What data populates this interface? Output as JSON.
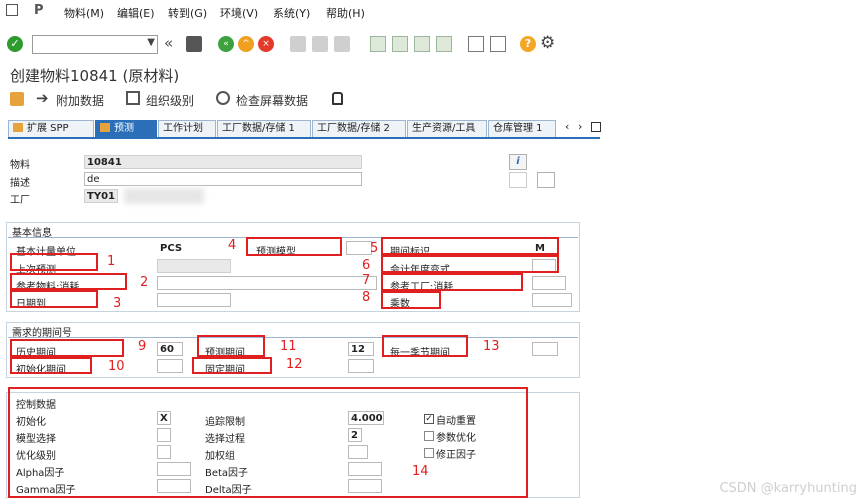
{
  "menu": {
    "items": [
      "物料(M)",
      "编辑(E)",
      "转到(G)",
      "环境(V)",
      "系统(Y)",
      "帮助(H)"
    ]
  },
  "title": "创建物料10841 (原材料)",
  "app_toolbar": {
    "additional_data": "附加数据",
    "org_levels": "组织级别",
    "check_screen": "检查屏幕数据"
  },
  "tabs": [
    "扩展 SPP",
    "预测",
    "工作计划",
    "工厂数据/存储 1",
    "工厂数据/存储 2",
    "生产资源/工具",
    "仓库管理 1"
  ],
  "active_tab": "预测",
  "header": {
    "material_label": "物料",
    "material_value": "10841",
    "desc_label": "描述",
    "desc_value": "de",
    "plant_label": "工厂",
    "plant_value": "TY01"
  },
  "basic": {
    "title": "基本信息",
    "base_unit_label": "基本计量单位",
    "base_unit_value": "PCS",
    "forecast_model_label": "预测模型",
    "period_indicator_label": "期间标识",
    "period_indicator_value": "M",
    "last_forecast_label": "上次预测",
    "fiscal_year_variant_label": "会计年度变式",
    "ref_material_label": "参考物料:消耗",
    "ref_plant_label": "参考工厂:消耗",
    "date_to_label": "日期到",
    "multiplier_label": "乘数"
  },
  "periods": {
    "title": "需求的期间号",
    "hist_label": "历史期间",
    "hist_value": "60",
    "forecast_label": "预测期间",
    "forecast_value": "12",
    "season_label": "每一季节期间",
    "init_label": "初始化期间",
    "fixed_label": "固定期间"
  },
  "control": {
    "title": "控制数据",
    "init_label": "初始化",
    "init_value": "X",
    "tracking_label": "追踪限制",
    "tracking_value": "4.000",
    "auto_reset_label": "自动重置",
    "model_sel_label": "模型选择",
    "sel_proc_label": "选择过程",
    "sel_proc_value": "2",
    "param_opt_label": "参数优化",
    "opt_level_label": "优化级别",
    "weight_group_label": "加权组",
    "correction_label": "修正因子",
    "alpha_label": "Alpha因子",
    "beta_label": "Beta因子",
    "gamma_label": "Gamma因子",
    "delta_label": "Delta因子"
  },
  "annotations": [
    "1",
    "2",
    "3",
    "4",
    "5",
    "6",
    "7",
    "8",
    "9",
    "10",
    "11",
    "12",
    "13",
    "14"
  ],
  "watermark": "CSDN @karryhunting",
  "colors": {
    "tab_active": "#2a6fb8",
    "annotation": "#e02020",
    "ok_green": "#2e9b2e",
    "nav_green": "#3da23d",
    "nav_orange": "#f0a020",
    "help_orange": "#f5a623"
  }
}
